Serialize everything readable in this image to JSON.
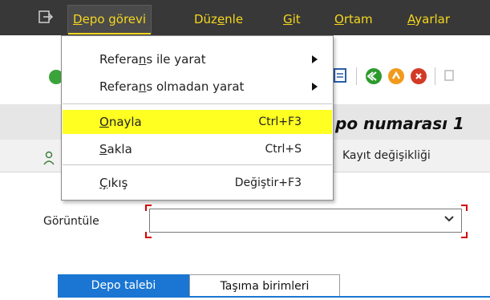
{
  "menubar": {
    "items": [
      {
        "pre": "",
        "ul": "D",
        "post": "epo görevi"
      },
      {
        "pre": "Düz",
        "ul": "e",
        "post": "nle"
      },
      {
        "pre": "",
        "ul": "G",
        "post": "it"
      },
      {
        "pre": "",
        "ul": "O",
        "post": "rtam"
      },
      {
        "pre": "",
        "ul": "A",
        "post": "yarlar"
      }
    ]
  },
  "dropdown": {
    "items": [
      {
        "pre": "Refera",
        "ul": "n",
        "post": "s ile yarat",
        "shortcut": "",
        "submenu": true
      },
      {
        "pre": "Refera",
        "ul": "n",
        "post": "s olmadan yarat",
        "shortcut": "",
        "submenu": true
      },
      {
        "pre": "",
        "ul": "O",
        "post": "nayla",
        "shortcut": "Ctrl+F3",
        "submenu": false
      },
      {
        "pre": "",
        "ul": "S",
        "post": "akla",
        "shortcut": "Ctrl+S",
        "submenu": false
      },
      {
        "pre": "",
        "ul": "Ç",
        "post": "ıkış",
        "shortcut": "Değiştir+F3",
        "submenu": false
      }
    ]
  },
  "header": {
    "title_fragment": "po numarası 1",
    "tab_label": "Kayıt değişikliği"
  },
  "form": {
    "display_label": "Görüntüle",
    "display_value": ""
  },
  "bottom_tabs": [
    "Depo talebi",
    "Taşıma birimleri"
  ],
  "colors": {
    "menubar_bg": "#383838",
    "menu_text": "#f5d61e",
    "highlight": "#ffff22",
    "tab_active": "#1a76d2",
    "required_marker": "#d40000"
  }
}
